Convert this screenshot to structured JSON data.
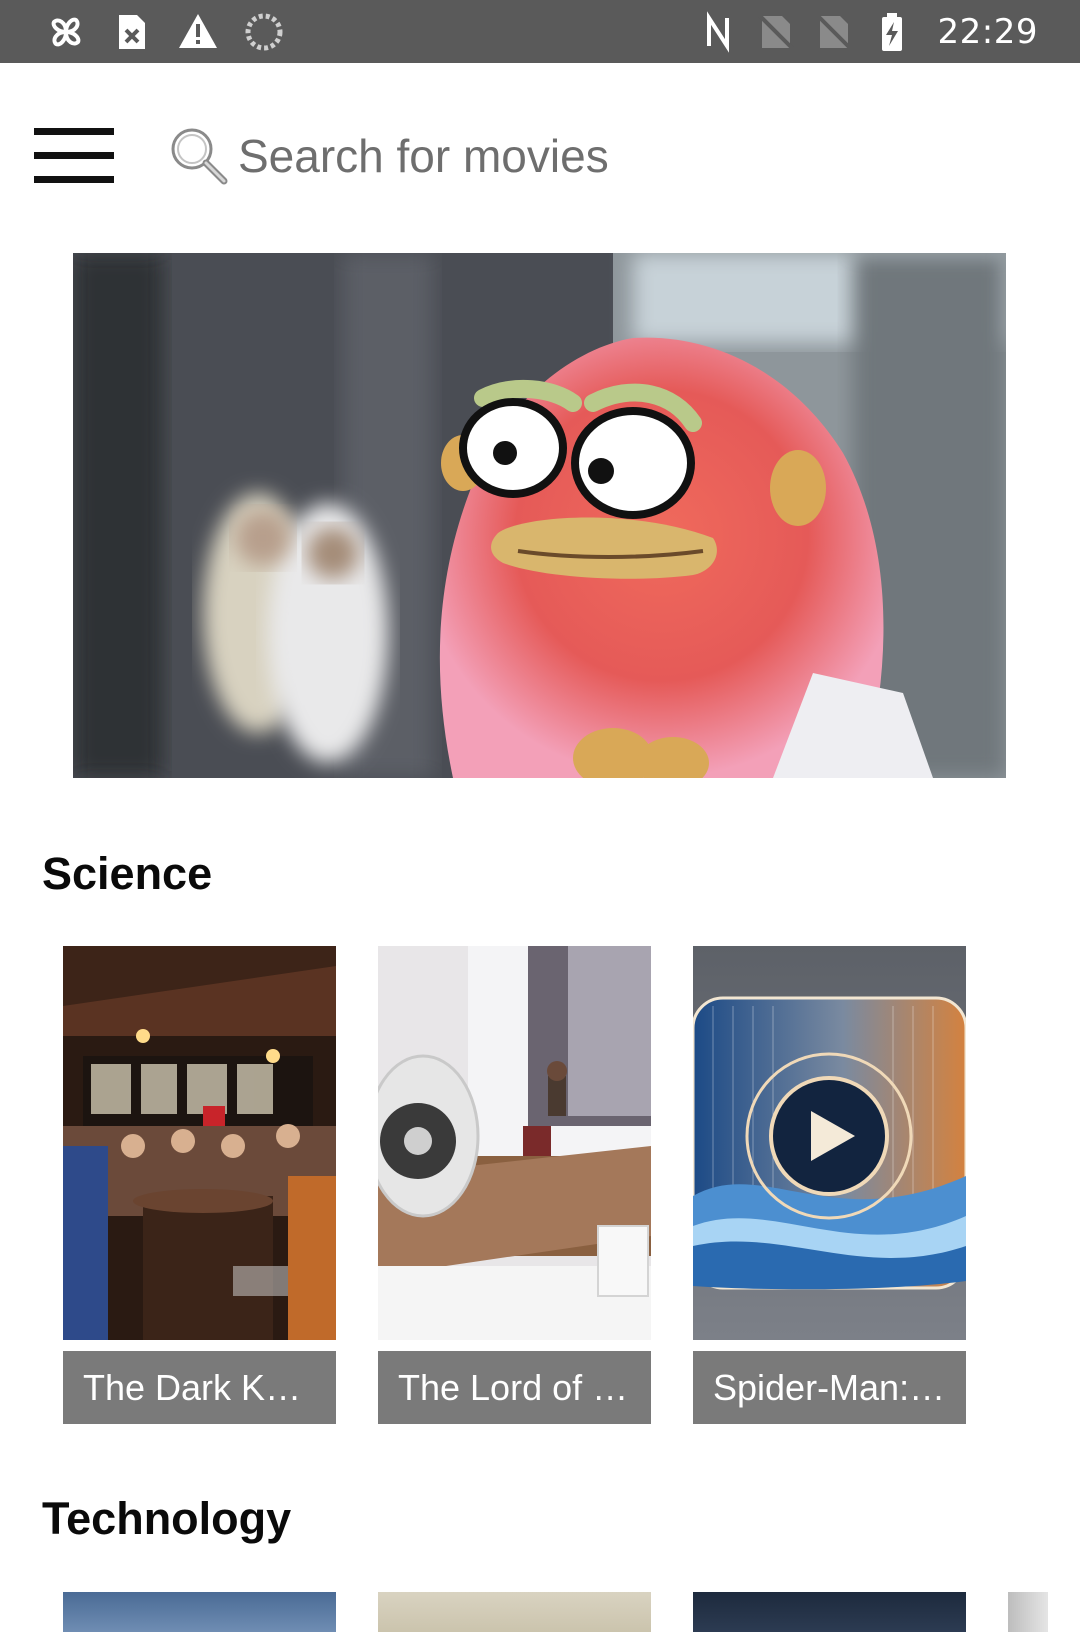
{
  "status_bar": {
    "time": "22:29",
    "left_icons": [
      "pinwheel-icon",
      "sim-error-icon",
      "warning-icon",
      "loading-icon"
    ],
    "right_icons": [
      "nfc-icon",
      "no-sim-icon",
      "no-sim-icon",
      "battery-charging-icon"
    ]
  },
  "app_bar": {
    "menu_icon": "hamburger-menu-icon",
    "search": {
      "icon": "search-icon",
      "placeholder": "Search for movies"
    }
  },
  "hero": {
    "image": "fuzzy-pink-puppet-banner"
  },
  "sections": [
    {
      "title": "Science",
      "items": [
        {
          "title": "The Dark Kni...",
          "thumbnail": "crowded-bar-photo"
        },
        {
          "title": "The Lord of t...",
          "thumbnail": "desk-speaker-photo"
        },
        {
          "title": "Spider-Man: ...",
          "thumbnail": "play-button-wave-art"
        }
      ]
    },
    {
      "title": "Technology",
      "items": [
        {
          "thumbnail": "city-skyline-photo"
        },
        {
          "thumbnail": "pale-sky-photo"
        },
        {
          "thumbnail": "dark-blue-photo"
        },
        {
          "thumbnail": "grey-partial-photo"
        }
      ]
    }
  ],
  "colors": {
    "status_bar_bg": "#5a5a5a",
    "caption_bg": "#7a7a7a",
    "caption_text": "#ffffff",
    "placeholder_text": "#6e6e6e"
  }
}
